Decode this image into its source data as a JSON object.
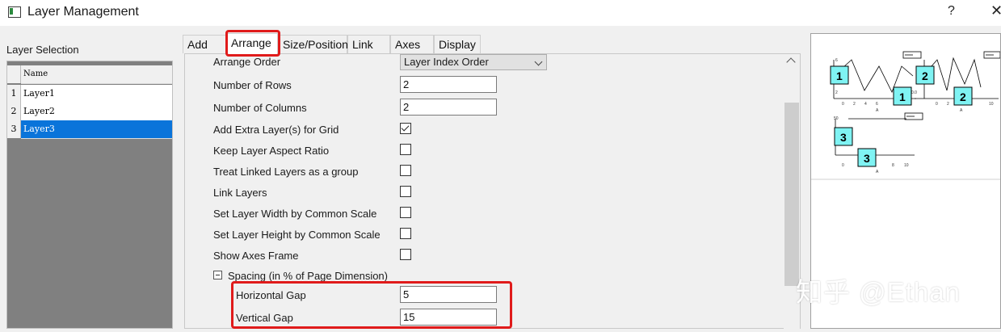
{
  "window": {
    "title": "Layer Management",
    "help_label": "?",
    "close_label": "✕"
  },
  "layer_selection": {
    "label": "Layer Selection",
    "header": "Name",
    "rows": [
      {
        "num": "1",
        "name": "Layer1",
        "selected": false
      },
      {
        "num": "2",
        "name": "Layer2",
        "selected": false
      },
      {
        "num": "3",
        "name": "Layer3",
        "selected": true
      }
    ]
  },
  "tabs": [
    {
      "label": "Add",
      "active": false
    },
    {
      "label": "Arrange",
      "active": true
    },
    {
      "label": "Size/Position",
      "active": false
    },
    {
      "label": "Link",
      "active": false
    },
    {
      "label": "Axes",
      "active": false
    },
    {
      "label": "Display",
      "active": false
    }
  ],
  "arrange": {
    "arrange_order": {
      "label": "Arrange Order",
      "value": "Layer Index Order"
    },
    "rows": {
      "label": "Number of Rows",
      "value": "2"
    },
    "columns": {
      "label": "Number of Columns",
      "value": "2"
    },
    "checkboxes": [
      {
        "label": "Add Extra Layer(s) for Grid",
        "checked": true
      },
      {
        "label": "Keep Layer Aspect Ratio",
        "checked": false
      },
      {
        "label": "Treat Linked Layers as a group",
        "checked": false
      },
      {
        "label": "Link Layers",
        "checked": false
      },
      {
        "label": "Set Layer Width by Common Scale",
        "checked": false
      },
      {
        "label": "Set Layer Height by Common Scale",
        "checked": false
      },
      {
        "label": "Show Axes Frame",
        "checked": false
      }
    ],
    "spacing": {
      "label": "Spacing (in % of Page Dimension)",
      "expanded": true
    },
    "horizontal_gap": {
      "label": "Horizontal Gap",
      "value": "5"
    },
    "vertical_gap": {
      "label": "Vertical Gap",
      "value": "15"
    }
  },
  "preview": {
    "layer_labels": [
      "1",
      "2",
      "3",
      "1",
      "2",
      "3"
    ],
    "axis_label": "A"
  },
  "watermark": "知乎 @Ethan",
  "colors": {
    "highlight": "#e01b1b",
    "selection": "#0a74da",
    "layer_box": "#7ff3f3"
  }
}
